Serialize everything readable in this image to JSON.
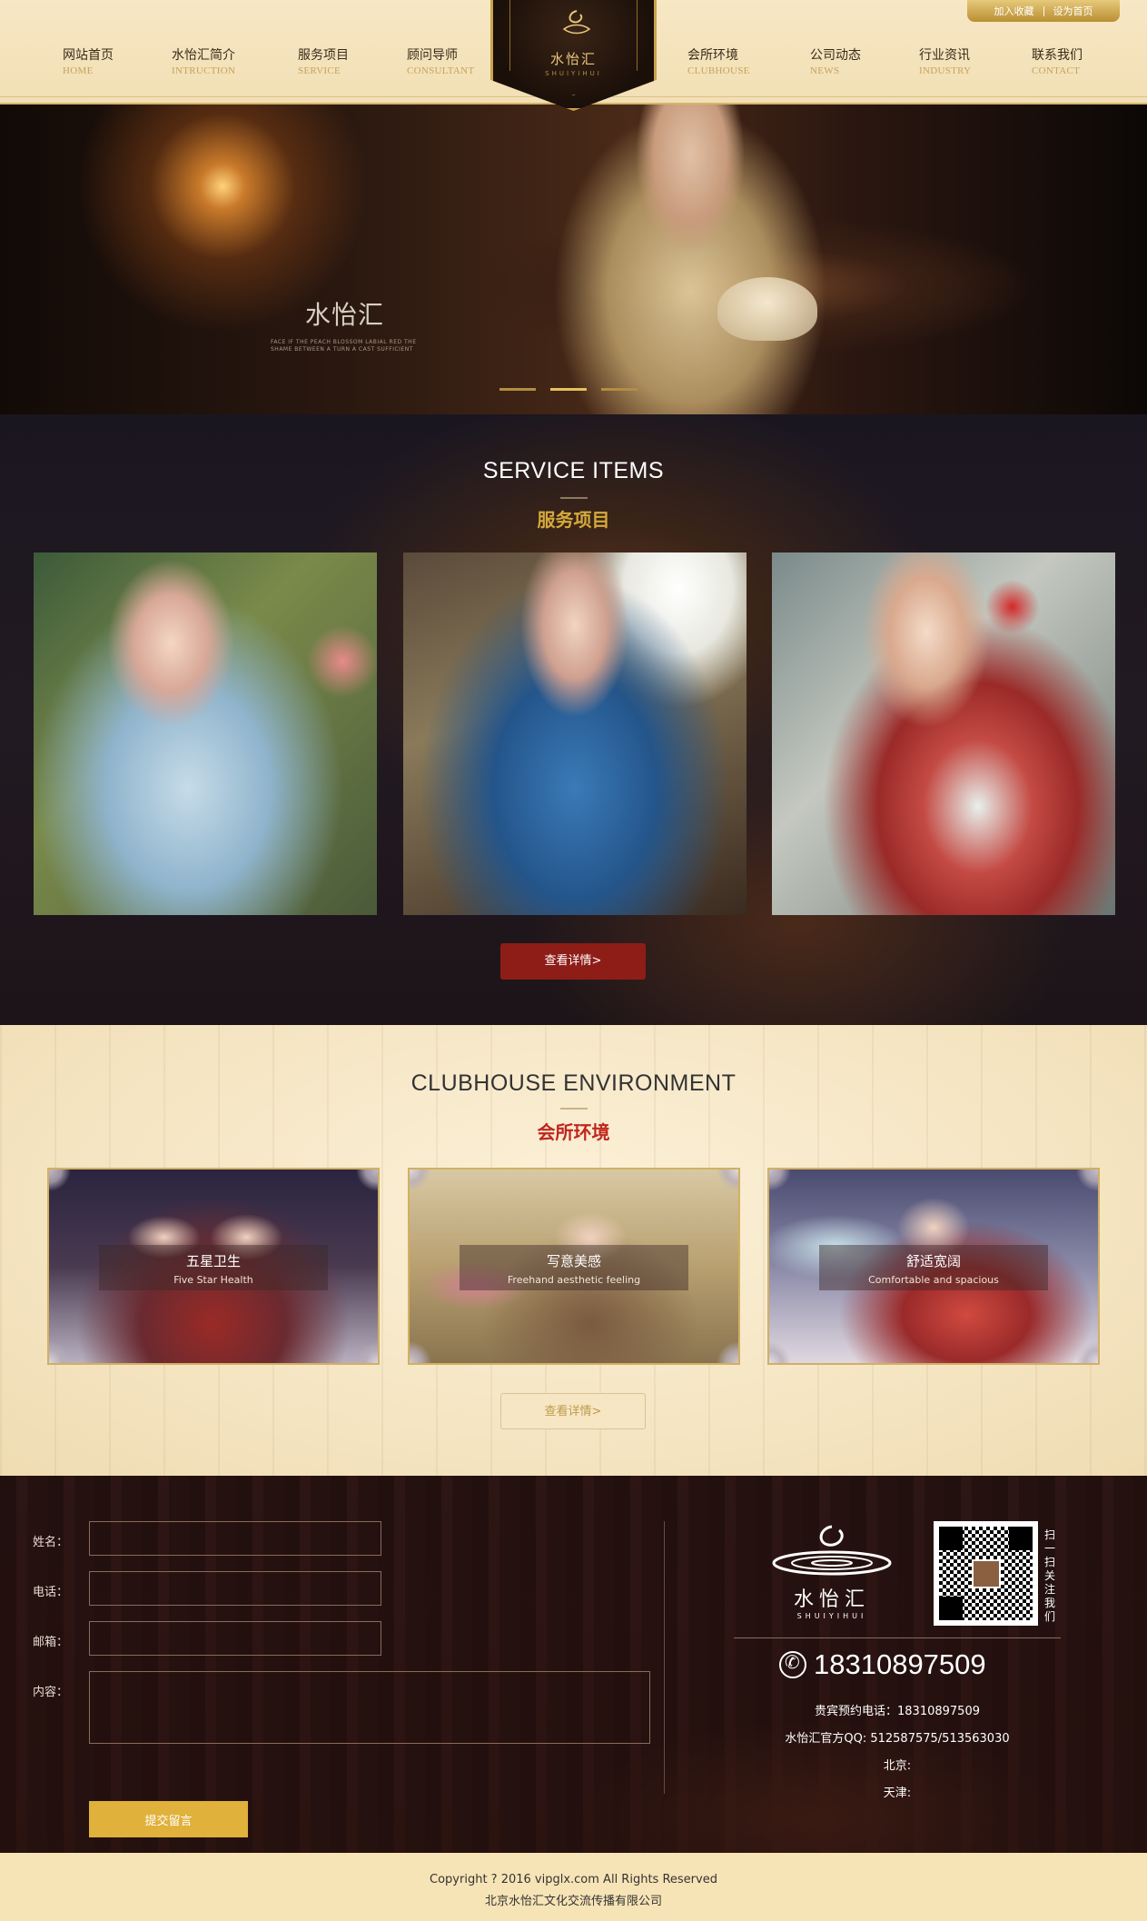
{
  "topbar": {
    "favorite": "加入收藏",
    "homepage": "设为首页"
  },
  "nav": {
    "items": [
      {
        "cn": "网站首页",
        "en": "HOME"
      },
      {
        "cn": "水怡汇简介",
        "en": "INTRUCTION"
      },
      {
        "cn": "服务项目",
        "en": "SERVICE"
      },
      {
        "cn": "顾问导师",
        "en": "CONSULTANT"
      },
      {
        "cn": "会所环境",
        "en": "CLUBHOUSE"
      },
      {
        "cn": "公司动态",
        "en": "NEWS"
      },
      {
        "cn": "行业资讯",
        "en": "INDUSTRY"
      },
      {
        "cn": "联系我们",
        "en": "CONTACT"
      }
    ]
  },
  "logo": {
    "name": "水怡汇",
    "sub": "SHUIYIHUI"
  },
  "hero": {
    "title": "水怡汇",
    "subtitle": "FACE IF THE PEACH BLOSSOM LABIAL RED THE SHAME BETWEEN A TURN A CAST SUFFICIENT"
  },
  "service": {
    "title_en": "SERVICE ITEMS",
    "title_cn": "服务项目",
    "button": "查看详情>"
  },
  "club": {
    "title_en": "CLUBHOUSE ENVIRONMENT",
    "title_cn": "会所环境",
    "button": "查看详情>",
    "cards": [
      {
        "title": "五星卫生",
        "sub": "Five Star Health"
      },
      {
        "title": "写意美感",
        "sub": "Freehand aesthetic feeling"
      },
      {
        "title": "舒适宽阔",
        "sub": "Comfortable and spacious"
      }
    ]
  },
  "form": {
    "name_label": "姓名：",
    "phone_label": "电话：",
    "email_label": "邮箱：",
    "content_label": "内容：",
    "submit": "提交留言"
  },
  "footer": {
    "logo_name": "水怡汇",
    "logo_sub": "SHUIYIHUI",
    "qr_label": "扫一扫关注我们",
    "phone": "18310897509",
    "reserve": "贵宾预约电话：18310897509",
    "qq": "水怡汇官方QQ: 512587575/513563030",
    "beijing": "北京:",
    "tianjin": "天津:"
  },
  "copyright": {
    "line1": "Copyright ? 2016 vipglx.com All Rights Reserved",
    "line2": "北京水怡汇文化交流传播有限公司"
  },
  "colors": {
    "gold": "#c5a35c",
    "accent_red": "#c0261e",
    "button_red": "#8e1d17",
    "submit_yellow": "#e0b13b"
  }
}
